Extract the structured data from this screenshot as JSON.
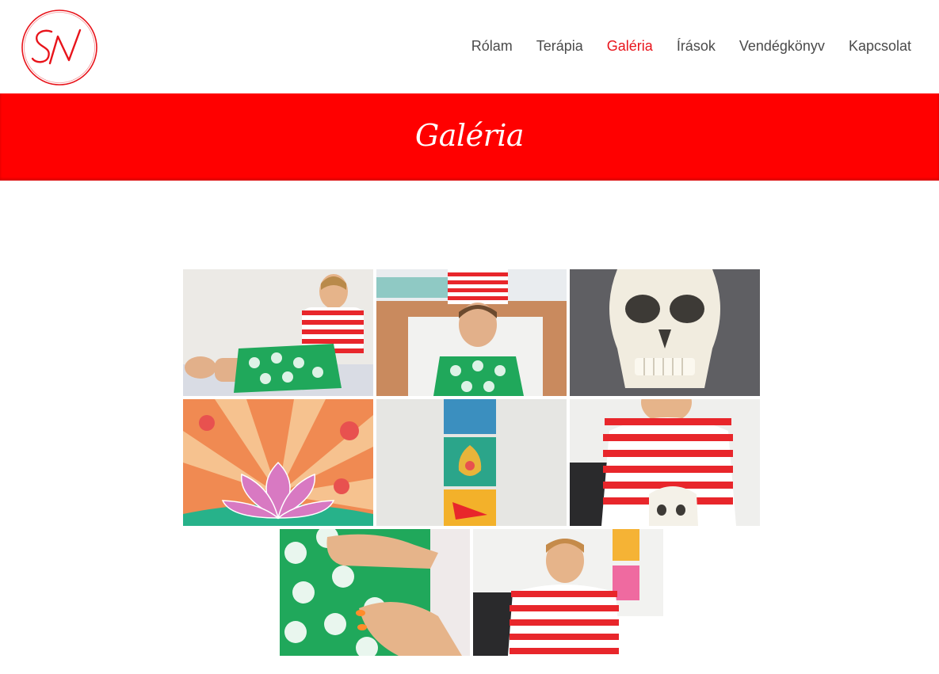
{
  "logo": {
    "monogram": "SN",
    "color": "#e8141b"
  },
  "nav": {
    "items": [
      "Rólam",
      "Terápia",
      "Galéria",
      "Írások",
      "Vendégkönyv",
      "Kapcsolat"
    ],
    "active": "Galéria"
  },
  "banner": {
    "title": "Galéria",
    "color": "#ff0000"
  },
  "gallery": {
    "images": [
      "therapy-session-side-photo",
      "head-massage-photo",
      "skull-model-photo",
      "lotus-silk-painting",
      "three-paintings-wall-photo",
      "smiling-therapist-with-skull-photo",
      "hands-on-abdomen-photo",
      "therapist-portrait-photo"
    ]
  }
}
